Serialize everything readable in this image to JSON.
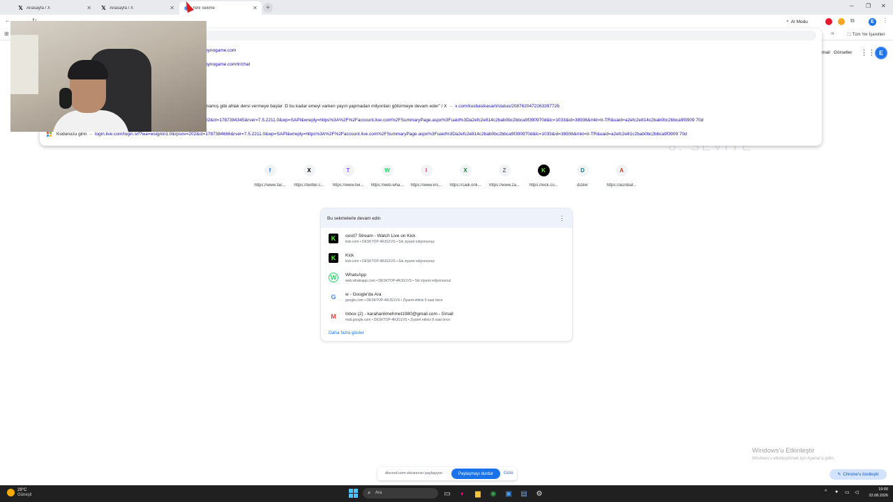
{
  "tabs": [
    {
      "title": "Anasayfa / X",
      "icon": "x-logo-icon"
    },
    {
      "title": "Anasayfa / X",
      "icon": "x-logo-icon"
    },
    {
      "title": "Yeni Sekme",
      "icon": "chrome-icon",
      "active": true
    }
  ],
  "toolbar": {
    "ai_mode_label": "AI Modu",
    "profile_initial": "E"
  },
  "bookmarks": {
    "overflow": "»",
    "all_bookmarks": "Tüm Yer İşaretleri"
  },
  "omnibox": {
    "suggestions": [
      {
        "prefix": "",
        "link": "bynogame.com",
        "suffix": ""
      },
      {
        "prefix": "",
        "link": "bynogame.com/tr/chat",
        "suffix": ""
      },
      {
        "prefix": "mamış gibi ahlak dersi vermeye başlar :D bu kadar emeyi varken yayın yapmadan milyonları götürmeye devam eder\" / X",
        "link": "x.com/kusbasikasarli/status/2087620472263397726",
        "suffix": ""
      },
      {
        "prefix": "",
        "link": "02&ct=1787384345&rver=7.5.2211.0&wp=SAPI&wreply=https%3A%2F%2Faccount.live.com%2FSummaryPage.aspx%3Fuaid%3Da2efc2e814c2bab0bc2bbca9f390970d&lc=1033&id=38936&mkt=tr-TR&uaid=a2efc2e814c2bab0bc2bbca9f3909 70d",
        "suffix": ""
      },
      {
        "prefix": "Kodunuzu girin",
        "link": "login.live.com/login.srf?wa=wsignin1.0&rpsnv=202&ct=1787384666&rver=7.5.2211.0&wp=SAPI&wreply=https%3A%2F%2Faccount.live.com%2FSummaryPage.aspx%3Fuaid%3Da2efc2e814c2bab0bc2bbca9f390970d&lc=1033&id=38936&mkt=tr-TR&uaid=a2efc2e81c2bab0bc2bbca9f3909 70d",
        "suffix": ""
      }
    ]
  },
  "google_links": {
    "gmail": "mail",
    "images": "Görseller",
    "profile_initial": "E"
  },
  "ghost_text": "8. SEVİYE",
  "shortcuts": [
    {
      "label": "https://www.fac...",
      "icon": "f",
      "color": "#1877f2"
    },
    {
      "label": "https://twitter.c...",
      "icon": "X",
      "color": "#000000"
    },
    {
      "label": "https://www.twi...",
      "icon": "T",
      "color": "#9146ff"
    },
    {
      "label": "https://web.wha...",
      "icon": "W",
      "color": "#25d366"
    },
    {
      "label": "https://www.ins...",
      "icon": "I",
      "color": "#e1306c"
    },
    {
      "label": "https://cadi.onli...",
      "icon": "X",
      "color": "#1b7f3a"
    },
    {
      "label": "https://www.za...",
      "icon": "Z",
      "color": "#6d6d80"
    },
    {
      "label": "https://kick.co...",
      "icon": "K",
      "color": "#53fc18"
    },
    {
      "label": "diziler",
      "icon": "D",
      "color": "#0b7a8a"
    },
    {
      "label": "https://acrobat...",
      "icon": "A",
      "color": "#c4452b"
    }
  ],
  "continue_card": {
    "title": "Bu sekmelerle devam edin",
    "items": [
      {
        "title": "cesit7 Stream - Watch Live on Kick",
        "sub": "kick.com • DESKTOP-4RJG1VS • Sık ziyaret ediyorsunuz",
        "icon": "K",
        "bg": "#53fc18",
        "fg": "#000000"
      },
      {
        "title": "Kick",
        "sub": "kick.com • DESKTOP-4RJG1VS • Sık ziyaret ediyorsunuz",
        "icon": "K",
        "bg": "#53fc18",
        "fg": "#000000"
      },
      {
        "title": "WhatsApp",
        "sub": "web.whatsapp.com • DESKTOP-4RJG1VS • Sık ziyaret ediyorsunuz",
        "icon": "W",
        "bg": "#ffffff",
        "fg": "#25d366"
      },
      {
        "title": "w - Google'da Ara",
        "sub": "google.com • DESKTOP-4RJG1VS • Ziyaret ettiniz 5 saat önce",
        "icon": "G",
        "bg": "#ffffff",
        "fg": "#4285f4"
      },
      {
        "title": "Inbox (2) - karahanlimehmet1980@gmail.com - Gmail",
        "sub": "mail.google.com • DESKTOP-4RJG1VS • Ziyaret ettiniz 8 saat önce",
        "icon": "M",
        "bg": "#ffffff",
        "fg": "#ea4335"
      }
    ],
    "more_label": "Daha fazla göster"
  },
  "watermark": {
    "title": "Windows'u Etkinleştir",
    "sub": "Windows'u etkinleştirmek için Ayarlar'a gidin."
  },
  "customize_label": "Chrome'u özelleştir",
  "sharebar": {
    "text": "discord.com ekranınızı paylaşıyor.",
    "stop": "Paylaşmayı durdur",
    "hide": "Gizle"
  },
  "taskbar": {
    "temp": "29°C",
    "weather": "Güneşli",
    "search": "Ara",
    "time": "19:00",
    "date": "22.08.2026"
  }
}
